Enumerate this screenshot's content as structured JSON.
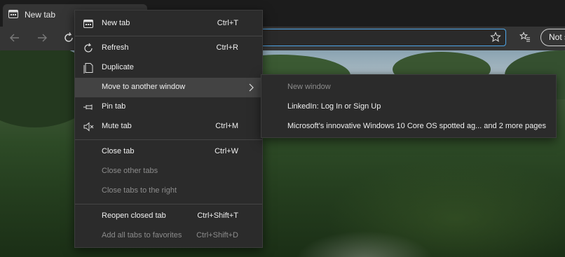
{
  "tab": {
    "title": "New tab",
    "icon": "new-tab-page-icon"
  },
  "toolbar": {
    "back_icon": "back-arrow-icon",
    "forward_icon": "forward-arrow-icon",
    "refresh_icon": "refresh-icon",
    "favorite_icon": "star-icon",
    "favorites_icon": "favorites-list-icon",
    "signin_label": "Not s"
  },
  "accent_color": "#4ea6e8",
  "context_menu": {
    "new_tab": {
      "label": "New tab",
      "shortcut": "Ctrl+T",
      "icon": "new-tab-icon"
    },
    "refresh": {
      "label": "Refresh",
      "shortcut": "Ctrl+R",
      "icon": "refresh-icon"
    },
    "duplicate": {
      "label": "Duplicate",
      "icon": "duplicate-icon"
    },
    "move": {
      "label": "Move to another window",
      "icon": "chevron-right-icon"
    },
    "pin": {
      "label": "Pin tab",
      "icon": "pin-icon"
    },
    "mute": {
      "label": "Mute tab",
      "shortcut": "Ctrl+M",
      "icon": "mute-icon"
    },
    "close": {
      "label": "Close tab",
      "shortcut": "Ctrl+W"
    },
    "close_other": {
      "label": "Close other tabs"
    },
    "close_right": {
      "label": "Close tabs to the right"
    },
    "reopen": {
      "label": "Reopen closed tab",
      "shortcut": "Ctrl+Shift+T"
    },
    "add_fav": {
      "label": "Add all tabs to favorites",
      "shortcut": "Ctrl+Shift+D"
    }
  },
  "submenu": {
    "items": [
      {
        "label": "New window"
      },
      {
        "label": "LinkedIn: Log In or Sign Up"
      },
      {
        "label": "Microsoft's innovative Windows 10 Core OS spotted ag... and 2 more pages"
      }
    ]
  }
}
